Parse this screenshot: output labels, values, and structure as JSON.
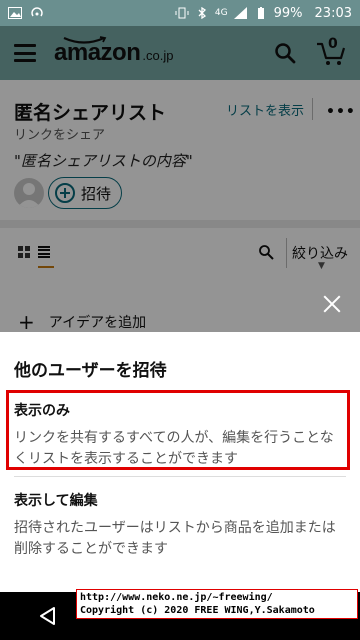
{
  "status_bar": {
    "network": "4G",
    "battery": "99%",
    "time": "23:03"
  },
  "header": {
    "logo_main": "amazon",
    "logo_sub": ".co.jp",
    "cart_count": "0"
  },
  "list": {
    "title": "匿名シェアリスト",
    "subtitle": "リンクをシェア",
    "show_list_label": "リストを表示",
    "more_label": "•••",
    "description": "\"匿名シェアリストの内容\"",
    "invite_label": "招待",
    "filter_label": "絞り込み",
    "add_idea_label": "アイデアを追加"
  },
  "sheet": {
    "title": "他のユーザーを招待",
    "options": [
      {
        "title": "表示のみ",
        "description": "リンクを共有するすべての人が、編集を行うことなくリストを表示することができます"
      },
      {
        "title": "表示して編集",
        "description": "招待されたユーザーはリストから商品を追加または削除することができます"
      }
    ]
  },
  "watermark": {
    "line1": "http://www.neko.ne.jp/~freewing/",
    "line2": "Copyright (c) 2020 FREE WING,Y.Sakamoto"
  },
  "colors": {
    "header_bg": "#78a9a6",
    "accent": "#0a6b7c",
    "highlight": "#e00000",
    "underline": "#c77a10"
  }
}
